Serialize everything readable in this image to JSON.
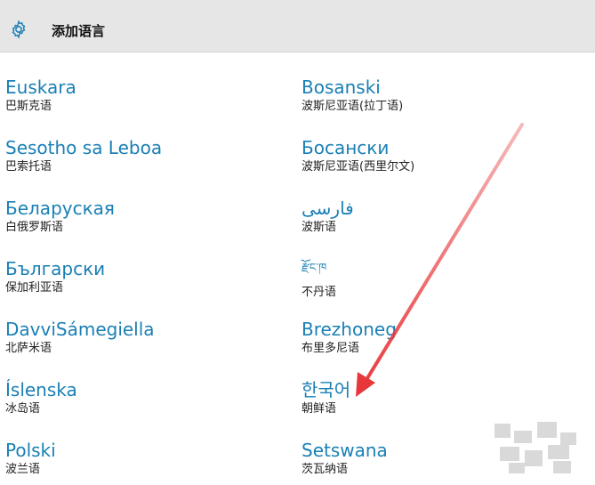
{
  "header": {
    "title": "添加语言",
    "icon": "gear-icon"
  },
  "languages": [
    {
      "native": "Euskara",
      "chinese": "巴斯克语"
    },
    {
      "native": "Bosanski",
      "chinese": "波斯尼亚语(拉丁语)"
    },
    {
      "native": "Sesotho sa Leboa",
      "chinese": "巴索托语"
    },
    {
      "native": "Босански",
      "chinese": "波斯尼亚语(西里尔文)"
    },
    {
      "native": "Беларуская",
      "chinese": "白俄罗斯语"
    },
    {
      "native": "فارسی",
      "chinese": "波斯语"
    },
    {
      "native": "Български",
      "chinese": "保加利亚语"
    },
    {
      "native": "རྫོང་ཁ",
      "chinese": "不丹语"
    },
    {
      "native": "DavviSámegiella",
      "chinese": "北萨米语"
    },
    {
      "native": "Brezhoneg",
      "chinese": "布里多尼语"
    },
    {
      "native": "Íslenska",
      "chinese": "冰岛语"
    },
    {
      "native": "한국어",
      "chinese": "朝鲜语"
    },
    {
      "native": "Polski",
      "chinese": "波兰语"
    },
    {
      "native": "Setswana",
      "chinese": "茨瓦纳语"
    }
  ],
  "colors": {
    "header_bg": "#e6e6e6",
    "accent": "#1a7fb5",
    "arrow": "#e8373a"
  }
}
